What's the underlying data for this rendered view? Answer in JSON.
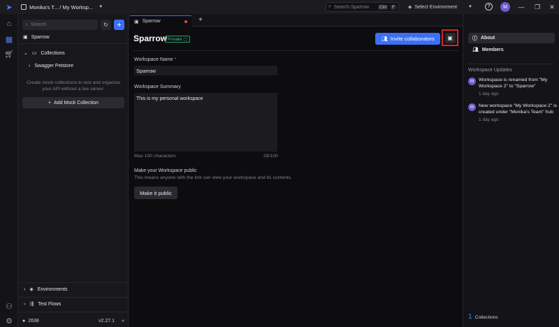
{
  "topbar": {
    "workspace_path": "Monika's T... / My Worksp...",
    "search_placeholder": "Search Sparrow",
    "shortcut_ctrl": "Ctrl",
    "shortcut_key": "F",
    "environment": "Select Environment",
    "avatar_initial": "M"
  },
  "sidebar": {
    "search_placeholder": "Search",
    "workspace_name": "Sparrow",
    "collections_label": "Collections",
    "collection_item": "Swagger Petstore",
    "mock_hint": "Create mock collections to test and organize your API without a live server.",
    "add_mock_label": "Add Mock Collection",
    "environments_label": "Environments",
    "test_flows_label": "Test Flows",
    "github_stars": "2638",
    "version": "v2.27.1"
  },
  "tabs": [
    {
      "label": "Sparrow",
      "unsaved": true
    }
  ],
  "main": {
    "title": "Sparrow",
    "badge": "Private",
    "invite_label": "Invite collaborators",
    "name_label": "Workspace Name",
    "required_mark": "*",
    "name_value": "Sparrow",
    "summary_label": "Workspace Summary",
    "summary_value": "This is my personal workspace",
    "max_chars": "Max 100 characters",
    "char_count": "29/100",
    "public_title": "Make your Workspace public",
    "public_desc": "This means anyone with the link can view your workspace and its contents.",
    "public_button": "Make it public"
  },
  "right_panel": {
    "about_label": "About",
    "members_label": "Members",
    "updates_heading": "Workspace Updates",
    "updates": [
      {
        "avatar": "M",
        "text": "Workspace is renamed from \"My Workspace 2\" to \"Sparrow\"",
        "time": "1 day ago"
      },
      {
        "avatar": "M",
        "text": "New workspace \"My Workspace 2\" is created under \"Monika's Team\" hub",
        "time": "1 day ago"
      }
    ],
    "collections_count": "1",
    "collections_label": "Collections"
  },
  "colors": {
    "accent": "#3b6ff5",
    "private_badge": "#3fcf8e",
    "highlight": "#e0202a",
    "unsaved_dot": "#e5484d"
  }
}
